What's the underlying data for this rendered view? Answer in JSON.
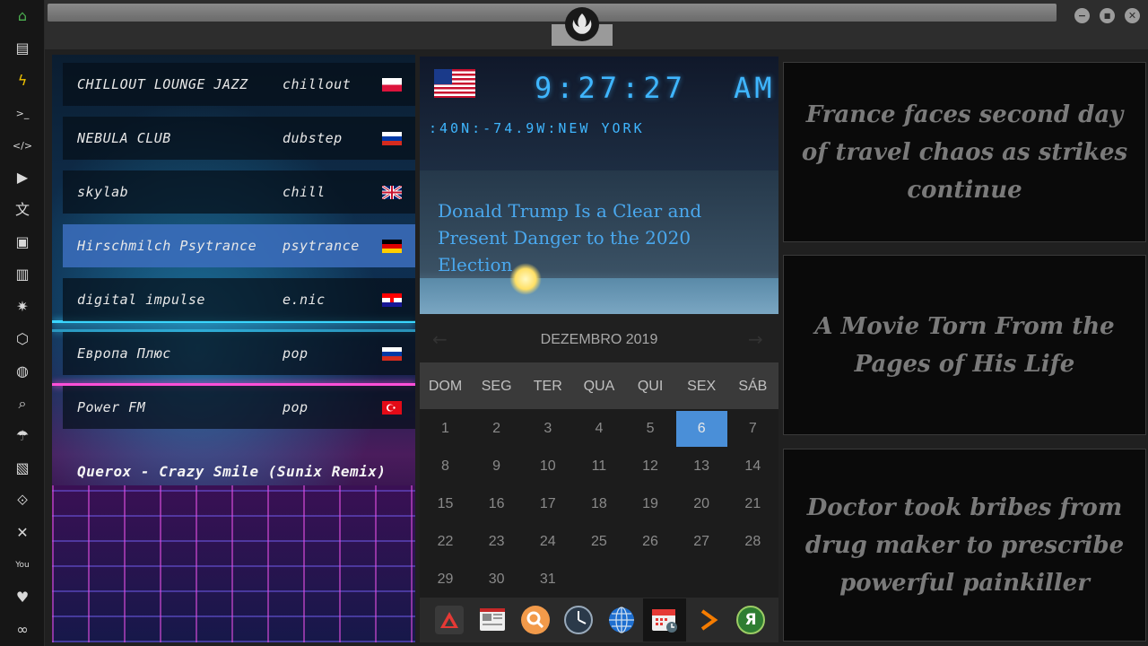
{
  "sidebar": {
    "items": [
      {
        "name": "home-icon",
        "glyph": "⌂"
      },
      {
        "name": "document-icon",
        "glyph": "▤"
      },
      {
        "name": "lightning-icon",
        "glyph": "ϟ"
      },
      {
        "name": "terminal-icon",
        "glyph": ">_"
      },
      {
        "name": "code-icon",
        "glyph": "</>"
      },
      {
        "name": "play-icon",
        "glyph": "▶"
      },
      {
        "name": "translate-icon",
        "glyph": "文"
      },
      {
        "name": "image-icon",
        "glyph": "▣"
      },
      {
        "name": "news-icon",
        "glyph": "▥"
      },
      {
        "name": "rebel-alliance-icon",
        "glyph": "✷"
      },
      {
        "name": "hexagon-icon",
        "glyph": "⬡"
      },
      {
        "name": "globe-icon",
        "glyph": "◍"
      },
      {
        "name": "search-icon",
        "glyph": "⌕"
      },
      {
        "name": "umbrella-icon",
        "glyph": "☂"
      },
      {
        "name": "contacts-icon",
        "glyph": "▧"
      },
      {
        "name": "link-icon",
        "glyph": "⟐"
      },
      {
        "name": "tools-icon",
        "glyph": "✕"
      },
      {
        "name": "youtube-icon",
        "glyph": "You"
      },
      {
        "name": "heart-icon",
        "glyph": "♥"
      },
      {
        "name": "infinity-icon",
        "glyph": "∞"
      }
    ]
  },
  "window": {
    "minimize": "−",
    "maximize": "■",
    "close": "✕"
  },
  "radio": {
    "stations": [
      {
        "name": "CHILLOUT LOUNGE JAZZ",
        "genre": "chillout",
        "flag": "poland"
      },
      {
        "name": "NEBULA CLUB",
        "genre": "dubstep",
        "flag": "russia"
      },
      {
        "name": "skylab",
        "genre": "chill",
        "flag": "uk"
      },
      {
        "name": "Hirschmilch Psytrance",
        "genre": "psytrance",
        "flag": "germany"
      },
      {
        "name": "digital impulse",
        "genre": "e.nic",
        "flag": "croatia"
      },
      {
        "name": "Европа Плюс",
        "genre": "pop",
        "flag": "russia"
      },
      {
        "name": "Power FM",
        "genre": "pop",
        "flag": "turkey"
      }
    ],
    "now_playing": "Querox - Crazy Smile (Sunix Remix)"
  },
  "clock": {
    "time": "9:27:27",
    "ampm": "AM",
    "location": ":40N:-74.9W:NEW YORK"
  },
  "news_top": {
    "headline": "Donald Trump Is a Clear and Present Danger to the 2020 Election"
  },
  "calendar": {
    "title": "DEZEMBRO 2019",
    "prev": "←",
    "next": "→",
    "weekdays": [
      "DOM",
      "SEG",
      "TER",
      "QUA",
      "QUI",
      "SEX",
      "SÁB"
    ],
    "days": [
      "1",
      "2",
      "3",
      "4",
      "5",
      "6",
      "7",
      "8",
      "9",
      "10",
      "11",
      "12",
      "13",
      "14",
      "15",
      "16",
      "17",
      "18",
      "19",
      "20",
      "21",
      "22",
      "23",
      "24",
      "25",
      "26",
      "27",
      "28",
      "29",
      "30",
      "31"
    ],
    "today": "6"
  },
  "launcher": {
    "apps": [
      "triangle-app-icon",
      "news-app-icon",
      "search-app-icon",
      "clock-app-icon",
      "globe-app-icon",
      "calendar-app-icon",
      "play-arrow-app-icon",
      "yandex-app-icon"
    ],
    "yandex_letter": "Я"
  },
  "headlines": [
    "France faces second day of travel chaos as strikes continue",
    "A Movie Torn From the Pages of His Life",
    "Doctor took bribes from drug maker to prescribe powerful painkiller"
  ],
  "colors": {
    "clock_digits": "#3fb6ff",
    "today_highlight": "#4a8fd8",
    "active_station": "#3c6ebe",
    "home_icon": "#4caf50",
    "lightning_icon": "#f2c400"
  }
}
